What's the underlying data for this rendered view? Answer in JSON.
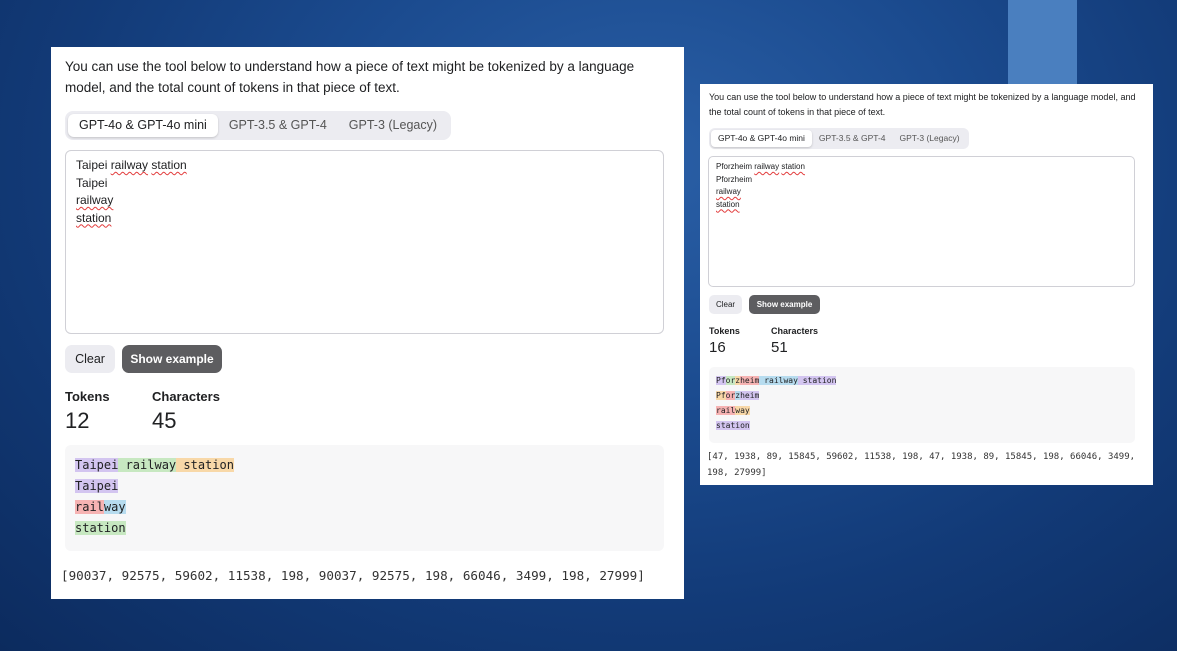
{
  "panels": [
    {
      "intro": "You can use the tool below to understand how a piece of text might be tokenized by a language model, and the total count of tokens in that piece of text.",
      "tabs": [
        "GPT-4o & GPT-4o mini",
        "GPT-3.5 & GPT-4",
        "GPT-3 (Legacy)"
      ],
      "active_tab": "GPT-4o & GPT-4o mini",
      "input_lines": [
        [
          "Taipei ",
          "railway",
          " ",
          "station"
        ],
        [
          "Taipei"
        ],
        [
          "railway"
        ],
        [
          "station"
        ]
      ],
      "clear_label": "Clear",
      "example_label": "Show example",
      "tokens_label": "Tokens",
      "tokens_value": "12",
      "characters_label": "Characters",
      "characters_value": "45",
      "tokens": [
        [
          "Taipei",
          " railway",
          " station"
        ],
        [
          "Taipei"
        ],
        [
          "rail",
          "way"
        ],
        [
          "station"
        ]
      ],
      "token_ids": "[90037, 92575, 59602, 11538, 198, 90037, 92575, 198, 66046, 3499, 198, 27999]"
    },
    {
      "intro": "You can use the tool below to understand how a piece of text might be tokenized by a language model, and the total count of tokens in that piece of text.",
      "tabs": [
        "GPT-4o & GPT-4o mini",
        "GPT-3.5 & GPT-4",
        "GPT-3 (Legacy)"
      ],
      "active_tab": "GPT-4o & GPT-4o mini",
      "input_lines": [
        [
          "Pforzheim ",
          "railway",
          " ",
          "station"
        ],
        [
          "Pforzheim"
        ],
        [
          "railway"
        ],
        [
          "station"
        ]
      ],
      "clear_label": "Clear",
      "example_label": "Show example",
      "tokens_label": "Tokens",
      "tokens_value": "16",
      "characters_label": "Characters",
      "characters_value": "51",
      "tokens": [
        [
          "Pf",
          "or",
          "z",
          "heim",
          " railway",
          " station"
        ],
        [
          "Pf",
          "or",
          "z",
          "heim"
        ],
        [
          "rail",
          "way"
        ],
        [
          "station"
        ]
      ],
      "token_ids": "[47, 1938, 89, 15845, 59602, 11538, 198, 47, 1938, 89, 15845, 198, 66046, 3499, 198, 27999]"
    }
  ],
  "colors": {
    "token_palette": [
      "#d3c5f0",
      "#c7e8c1",
      "#f8d8a8",
      "#f6b3b3",
      "#b7dcef"
    ],
    "background": "#1b4b8f",
    "deco": "#4a7fbf"
  },
  "token_color_map": [
    [
      [
        0,
        1,
        2
      ],
      [
        0
      ],
      [
        3,
        4
      ],
      [
        1
      ]
    ],
    [
      [
        0,
        1,
        2,
        3,
        4,
        0
      ],
      [
        2,
        3,
        4,
        0
      ],
      [
        3,
        2
      ],
      [
        0
      ]
    ]
  ]
}
